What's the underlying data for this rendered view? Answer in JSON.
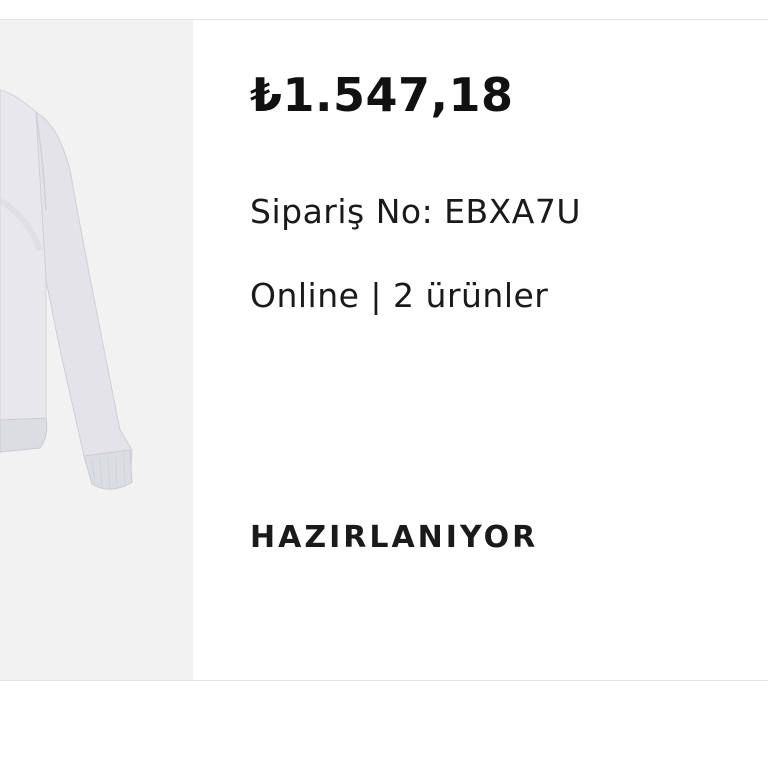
{
  "order": {
    "price": "₺1.547,18",
    "order_number": "Sipariş No: EBXA7U",
    "channel_and_items": "Online | 2 ürünler",
    "status": "HAZIRLANIYOR"
  },
  "thumbnail": {
    "icon": "sweatshirt-product-image",
    "background_color": "#f2f2f2",
    "garment_color": "#e6e6eb"
  }
}
